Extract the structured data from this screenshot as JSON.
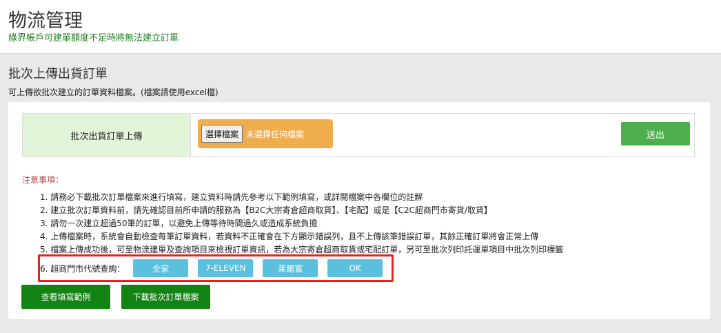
{
  "header": {
    "title": "物流管理",
    "warning": "綠界帳戶可建單額度不足時將無法建立訂單"
  },
  "section": {
    "title": "批次上傳出貨訂單",
    "description": "可上傳欲批次建立的訂單資料檔案。(檔案請使用excel檔)"
  },
  "upload": {
    "label": "批次出貨訂單上傳",
    "file_button": "選擇檔案",
    "file_status": "未選擇任何檔案",
    "submit": "送出"
  },
  "notes": {
    "title": "注意事項：",
    "items": [
      "1. 請務必下載批次訂單檔案來進行填寫，建立資料時請先參考以下範例填寫，或詳閱檔案中各欄位的註解",
      "2. 建立批次訂單資料前，請先確認目前所申請的服務為【B2C大宗寄倉超商取貨】、【宅配】或是【C2C超商門市寄貨/取貨】",
      "3. 請勿一次建立超過50筆的訂單，以避免上傳等待時間過久或造成系統負擔",
      "4. 上傳檔案時，系統會自動檢查每筆訂單資料，若資料不正確會在下方顯示錯誤列，且不上傳該筆錯誤訂單，其餘正確訂單將會正常上傳",
      "5. 檔案上傳成功後，可至物流建單及查詢項目來檢視訂單資訊，若為大宗寄倉超商取貨或宅配訂單，另可至批次列印託運單項目中批次列印標籤"
    ],
    "store_query_label": "6. 超商門市代號查詢：",
    "store_buttons": [
      "全家",
      "7-ELEVEN",
      "萊爾富",
      "OK"
    ]
  },
  "actions": {
    "view_sample": "查看填寫範例",
    "download_file": "下載批次訂單檔案"
  },
  "colors": {
    "success": "#4cae4c",
    "warning_orange": "#f0ad4e",
    "info": "#5bc0de",
    "dark_green": "#138413",
    "highlight_red": "#e8211e"
  }
}
